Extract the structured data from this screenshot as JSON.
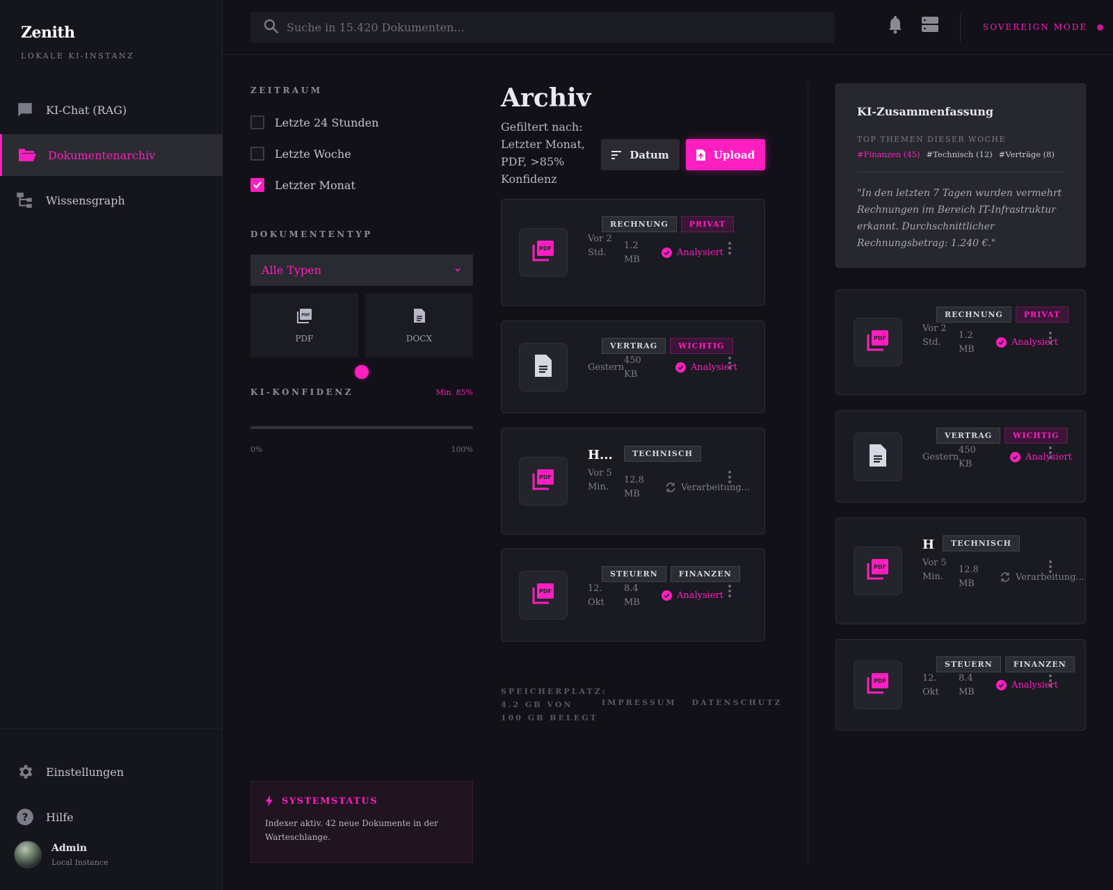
{
  "sidebar": {
    "brand": "Zenith",
    "brand_sub": "LOKALE KI-INSTANZ",
    "nav": [
      {
        "label": "KI-Chat (RAG)",
        "icon": "chat-icon"
      },
      {
        "label": "Dokumentenarchiv",
        "icon": "folder-open-icon",
        "active": true
      },
      {
        "label": "Wissensgraph",
        "icon": "graph-tree-icon"
      }
    ],
    "bottom_nav": [
      {
        "label": "Einstellungen",
        "icon": "gear-icon"
      },
      {
        "label": "Hilfe",
        "icon": "help-icon"
      }
    ],
    "user": {
      "name": "Admin",
      "sub": "Local Instance"
    }
  },
  "topbar": {
    "search_placeholder": "Suche in 15.420 Dokumenten...",
    "mode_label": "SOVEREIGN MODE"
  },
  "filters": {
    "timerange_label": "ZEITRAUM",
    "timerange_options": [
      {
        "label": "Letzte 24 Stunden",
        "checked": false
      },
      {
        "label": "Letzte Woche",
        "checked": false
      },
      {
        "label": "Letzter Monat",
        "checked": true
      }
    ],
    "doctype_label": "DOKUMENTENTYP",
    "doctype_selected": "Alle Typen",
    "doctype_tiles": [
      "PDF",
      "DOCX"
    ],
    "confidence_label": "KI-KONFIDENZ",
    "confidence_min": "Min. 85%",
    "confidence_value": 0.5,
    "slider_min": "0%",
    "slider_max": "100%"
  },
  "system_status": {
    "title": "SYSTEMSTATUS",
    "text": "Indexer aktiv. 42 neue Dokumente in der Warteschlange."
  },
  "archive": {
    "title": "Archiv",
    "filter_note": "Gefiltert nach: Letzter Monat, PDF, >85% Konfidenz",
    "date_button": "Datum",
    "upload_button": "Upload",
    "docs": [
      {
        "type": "pdf",
        "title": "",
        "tags": [
          {
            "t": "RECHNUNG",
            "pink": false
          },
          {
            "t": "PRIVAT",
            "pink": true
          }
        ],
        "time": "Vor 2 Std.",
        "size": "1.2 MB",
        "status": "Analysiert",
        "done": true
      },
      {
        "type": "doc",
        "title": "",
        "tags": [
          {
            "t": "VERTRAG",
            "pink": false
          },
          {
            "t": "WICHTIG",
            "pink": true
          }
        ],
        "time": "Gestern",
        "size": "450 KB",
        "status": "Analysiert",
        "done": true
      },
      {
        "type": "pdf",
        "title": "H...",
        "tags": [
          {
            "t": "TECHNISCH",
            "pink": false
          }
        ],
        "time": "Vor 5 Min.",
        "size": "12.8 MB",
        "status": "Verarbeitung...",
        "done": false
      },
      {
        "type": "pdf",
        "title": "",
        "tags": [
          {
            "t": "STEUERN",
            "pink": false
          },
          {
            "t": "FINANZEN",
            "pink": false
          }
        ],
        "time": "12. Okt",
        "size": "8.4 MB",
        "status": "Analysiert",
        "done": true
      }
    ]
  },
  "footer": {
    "storage": "SPEICHERPLATZ: 4.2 GB VON 100 GB BELEGT",
    "links": [
      "IMPRESSUM",
      "DATENSCHUTZ"
    ]
  },
  "summary": {
    "title": "KI-Zusammenfassung",
    "sub": "TOP THEMEN DIESER WOCHE",
    "topics": [
      {
        "label": "#Finanzen (45)",
        "hot": true
      },
      {
        "label": "#Technisch (12)",
        "hot": false
      },
      {
        "label": "#Verträge (8)",
        "hot": false
      }
    ],
    "quote": "\"In den letzten 7 Tagen wurden vermehrt Rechnungen im Bereich IT-Infrastruktur erkannt. Durchschnittlicher Rechnungsbetrag: 1.240 €.\""
  },
  "right_docs": [
    {
      "type": "pdf",
      "title": "",
      "tags": [
        {
          "t": "RECHNUNG",
          "pink": false
        },
        {
          "t": "PRIVAT",
          "pink": true
        }
      ],
      "time": "Vor 2 Std.",
      "size": "1.2 MB",
      "status": "Analysiert",
      "done": true
    },
    {
      "type": "doc",
      "title": "",
      "tags": [
        {
          "t": "VERTRAG",
          "pink": false
        },
        {
          "t": "WICHTIG",
          "pink": true
        }
      ],
      "time": "Gestern",
      "size": "450 KB",
      "status": "Analysiert",
      "done": true
    },
    {
      "type": "pdf",
      "title": "H",
      "tags": [
        {
          "t": "TECHNISCH",
          "pink": false
        }
      ],
      "time": "Vor 5 Min.",
      "size": "12.8 MB",
      "status": "Verarbeitung...",
      "done": false
    },
    {
      "type": "pdf",
      "title": "",
      "tags": [
        {
          "t": "STEUERN",
          "pink": false
        },
        {
          "t": "FINANZEN",
          "pink": false
        }
      ],
      "time": "12. Okt",
      "size": "8.4 MB",
      "status": "Analysiert",
      "done": true
    }
  ],
  "colors": {
    "accent": "#ff1ec0",
    "background": "#111117",
    "card": "#1a1a21"
  }
}
